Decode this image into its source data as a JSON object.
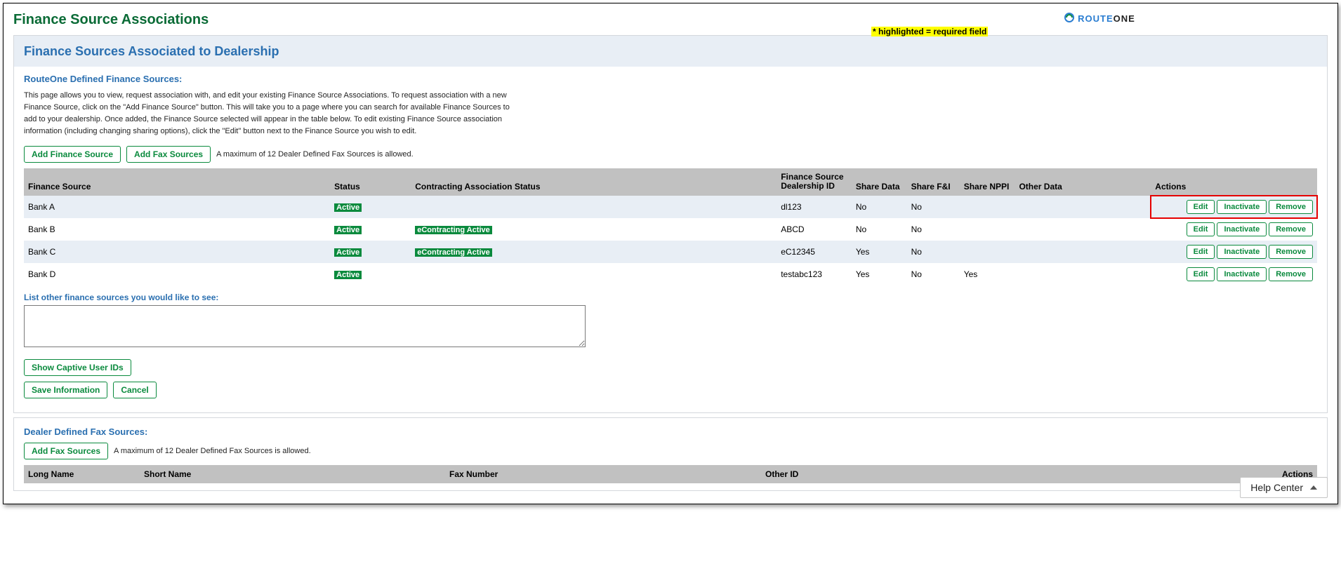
{
  "page": {
    "title": "Finance Source Associations",
    "panel_title": "Finance Sources Associated to Dealership",
    "subtitle": "RouteOne Defined Finance Sources:",
    "help_text": "This page allows you to view, request association with, and edit your existing Finance Source Associations. To request association with a new Finance Source, click on the \"Add Finance Source\" button. This will take you to a page where you can search for available Finance Sources to add to your dealership. Once added, the Finance Source selected will appear in the table below. To edit existing Finance Source association information (including changing sharing options), click the \"Edit\" button next to the Finance Source you wish to edit.",
    "required_note": "* highlighted = required field",
    "brand_route": "ROUTE",
    "brand_one": "ONE"
  },
  "buttons": {
    "add_finance_source": "Add Finance Source",
    "add_fax_sources": "Add Fax Sources",
    "show_captive": "Show Captive User IDs",
    "save_info": "Save Information",
    "cancel": "Cancel",
    "edit": "Edit",
    "inactivate": "Inactivate",
    "remove": "Remove",
    "help_center": "Help Center"
  },
  "notes": {
    "fax_max": "A maximum of 12 Dealer Defined Fax Sources is allowed."
  },
  "table": {
    "headers": {
      "finance_source": "Finance Source",
      "status": "Status",
      "cas": "Contracting Association Status",
      "did_l1": "Finance Source",
      "did_l2": "Dealership ID",
      "share_data": "Share Data",
      "share_fi": "Share F&I",
      "share_nppi": "Share NPPI",
      "other_data": "Other Data",
      "actions": "Actions"
    },
    "rows": [
      {
        "fs": "Bank A",
        "status": "Active",
        "cas": "",
        "did": "dl123",
        "sd": "No",
        "sf": "No",
        "sn": "",
        "od": "",
        "hl": true
      },
      {
        "fs": "Bank B",
        "status": "Active",
        "cas": "eContracting Active",
        "did": "ABCD",
        "sd": "No",
        "sf": "No",
        "sn": "",
        "od": "",
        "hl": false
      },
      {
        "fs": "Bank C",
        "status": "Active",
        "cas": "eContracting Active",
        "did": "eC12345",
        "sd": "Yes",
        "sf": "No",
        "sn": "",
        "od": "",
        "hl": false
      },
      {
        "fs": "Bank D",
        "status": "Active",
        "cas": "",
        "did": "testabc123",
        "sd": "Yes",
        "sf": "No",
        "sn": "Yes",
        "od": "",
        "hl": false
      }
    ]
  },
  "other_sources": {
    "label": "List other finance sources you would like to see:",
    "value": ""
  },
  "fax_panel": {
    "title": "Dealer Defined Fax Sources:",
    "headers": {
      "long_name": "Long Name",
      "short_name": "Short Name",
      "fax_number": "Fax Number",
      "other_id": "Other ID",
      "actions": "Actions"
    }
  }
}
